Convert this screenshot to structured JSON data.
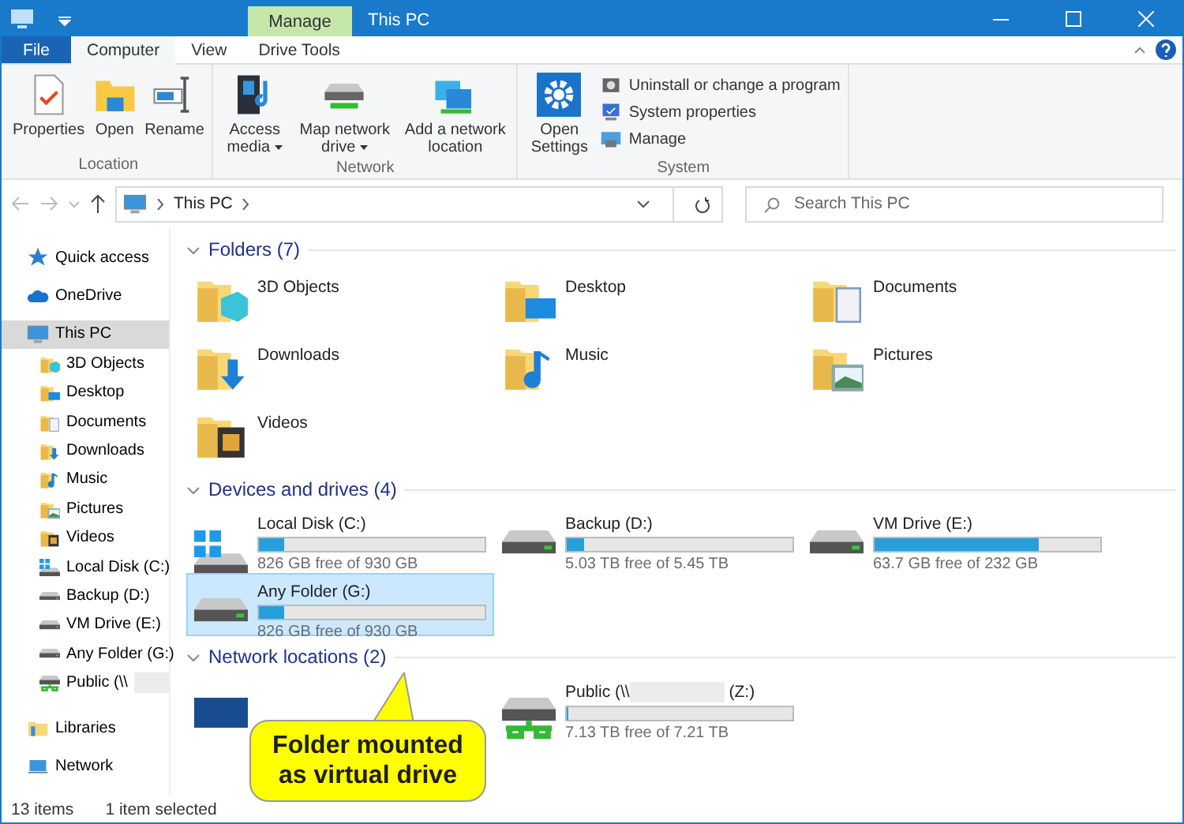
{
  "window": {
    "title": "This PC",
    "context_tab": "Manage"
  },
  "ribbon_tabs": [
    {
      "label": "File",
      "kind": "file",
      "selected": false
    },
    {
      "label": "Computer",
      "kind": "tab",
      "selected": true
    },
    {
      "label": "View",
      "kind": "tab",
      "selected": false
    },
    {
      "label": "Drive Tools",
      "kind": "tab",
      "selected": false
    }
  ],
  "ribbon_groups": [
    {
      "label": "Location",
      "buttons": [
        {
          "label": "Properties",
          "kind": "properties"
        },
        {
          "label": "Open",
          "kind": "open"
        },
        {
          "label": "Rename",
          "kind": "rename"
        }
      ]
    },
    {
      "label": "Network",
      "buttons": [
        {
          "label": "Access media",
          "kind": "media",
          "dropdown": true
        },
        {
          "label": "Map network drive",
          "kind": "mapdrive",
          "dropdown": true
        },
        {
          "label": "Add a network location",
          "kind": "addloc",
          "dropdown": false
        }
      ]
    },
    {
      "label": "System",
      "buttons": [
        {
          "label": "Open Settings",
          "kind": "settings"
        },
        {
          "label": "Uninstall or change a program",
          "kind": "uninstall"
        },
        {
          "label": "System properties",
          "kind": "sysprops"
        },
        {
          "label": "Manage",
          "kind": "manage"
        }
      ]
    }
  ],
  "address": {
    "path": "This PC"
  },
  "search": {
    "placeholder": "Search This PC"
  },
  "sidebar": {
    "items": [
      {
        "label": "Quick access",
        "kind": "star",
        "selected": false
      },
      {
        "label": "OneDrive",
        "kind": "cloud",
        "selected": false
      },
      {
        "label": "This PC",
        "kind": "pc",
        "selected": true,
        "children": [
          {
            "label": "3D Objects",
            "kind": "cube",
            "selected": false
          },
          {
            "label": "Desktop",
            "kind": "desktop",
            "selected": false
          },
          {
            "label": "Documents",
            "kind": "docs",
            "selected": false
          },
          {
            "label": "Downloads",
            "kind": "downloads",
            "selected": false
          },
          {
            "label": "Music",
            "kind": "music",
            "selected": false
          },
          {
            "label": "Pictures",
            "kind": "pictures",
            "selected": false
          },
          {
            "label": "Videos",
            "kind": "videos",
            "selected": false
          },
          {
            "label": "Local Disk (C:)",
            "kind": "windrive",
            "selected": false
          },
          {
            "label": "Backup (D:)",
            "kind": "drive",
            "selected": false
          },
          {
            "label": "VM Drive (E:)",
            "kind": "drive",
            "selected": false
          },
          {
            "label": "Any Folder (G:)",
            "kind": "drive",
            "selected": false
          },
          {
            "label": "Public (\\\\",
            "kind": "netdrive",
            "selected": false,
            "redacted": true
          }
        ]
      },
      {
        "label": "Libraries",
        "kind": "libraries",
        "selected": false
      },
      {
        "label": "Network",
        "kind": "network",
        "selected": false
      }
    ]
  },
  "sections": [
    {
      "title": "Folders (7)",
      "kind": "folders",
      "expanded": true,
      "items": [
        {
          "name": "3D Objects",
          "kind": "cube"
        },
        {
          "name": "Desktop",
          "kind": "desktop"
        },
        {
          "name": "Documents",
          "kind": "docs"
        },
        {
          "name": "Downloads",
          "kind": "downloads"
        },
        {
          "name": "Music",
          "kind": "music"
        },
        {
          "name": "Pictures",
          "kind": "pictures"
        },
        {
          "name": "Videos",
          "kind": "videos"
        }
      ]
    },
    {
      "title": "Devices and drives (4)",
      "kind": "drives",
      "expanded": true,
      "items": [
        {
          "name": "Local Disk (C:)",
          "kind": "windrive",
          "level": 0.11,
          "free": "826 GB free of 930 GB",
          "selected": false
        },
        {
          "name": "Backup (D:)",
          "kind": "drive",
          "level": 0.08,
          "free": "5.03 TB free of 5.45 TB",
          "selected": false
        },
        {
          "name": "VM Drive (E:)",
          "kind": "drive",
          "level": 0.73,
          "free": "63.7 GB free of 232 GB",
          "selected": false
        },
        {
          "name": "Any Folder (G:)",
          "kind": "drive",
          "level": 0.11,
          "free": "826 GB free of 930 GB",
          "selected": true
        }
      ]
    },
    {
      "title": "Network locations (2)",
      "kind": "drives",
      "expanded": true,
      "items": [
        {
          "kind": "logo",
          "selected": false
        },
        {
          "name": "Public (\\\\",
          "redacted": true,
          "suffix": "(Z:)",
          "kind": "netdrive",
          "level": 0.01,
          "free": "7.13 TB free of 7.21 TB",
          "selected": false
        }
      ]
    }
  ],
  "callout": {
    "text": "Folder mounted as virtual drive"
  },
  "status_bar": {
    "count": "13 items",
    "selection": "1 item selected"
  }
}
